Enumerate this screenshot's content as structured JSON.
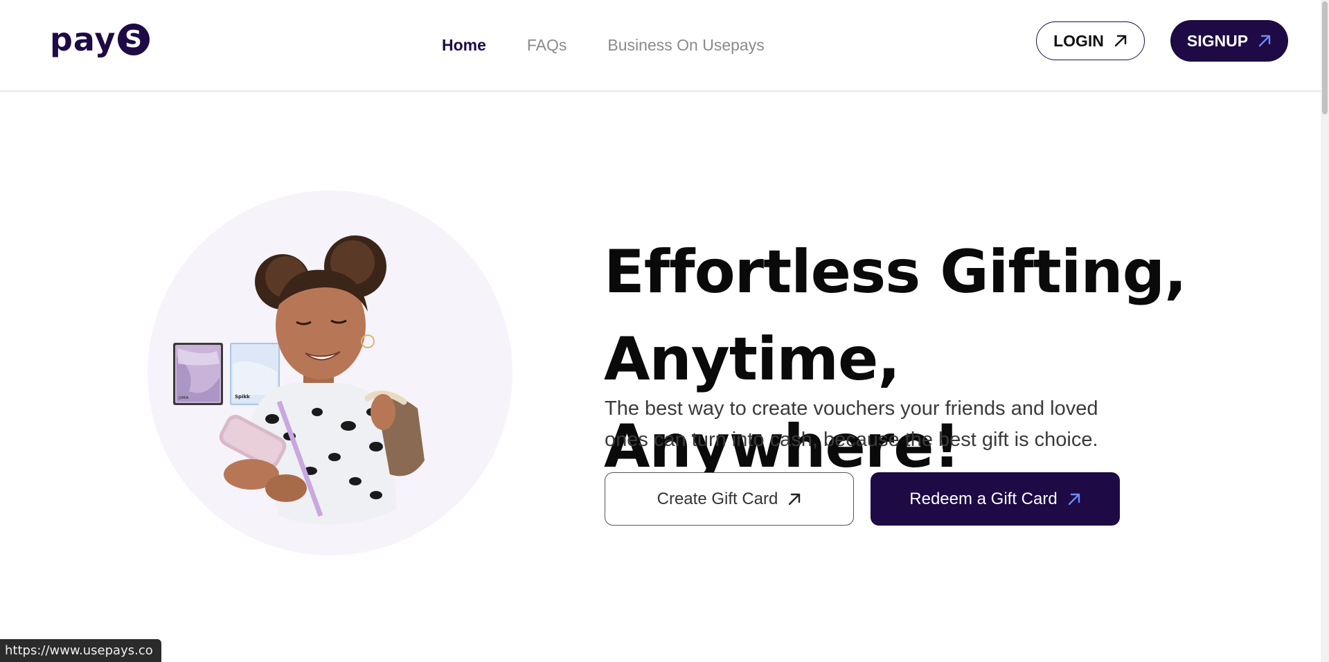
{
  "logo": {
    "text": "pay",
    "badge": "S"
  },
  "nav": {
    "items": [
      {
        "label": "Home"
      },
      {
        "label": "FAQs"
      },
      {
        "label": "Business On Usepays"
      }
    ]
  },
  "header": {
    "login_label": "LOGIN",
    "signup_label": "SIGNUP"
  },
  "hero": {
    "headline_line1": "Effortless Gifting,",
    "headline_line2": "Anytime, Anywhere!",
    "subtitle": "The best way to create vouchers your friends and loved ones can turn into cash, because the best gift is choice.",
    "create_label": "Create Gift Card",
    "redeem_label": "Redeem a Gift Card",
    "card_brands": [
      "JUMIA",
      "Spikk"
    ]
  },
  "statusbar": {
    "url": "https://www.usepays.co"
  },
  "colors": {
    "brand": "#1e0a45",
    "arrow_accent": "#6b8bff",
    "hero_circle": "#f6f3fa",
    "nav_inactive": "#8a8a8a"
  },
  "icons": [
    "arrow-up-right-icon"
  ]
}
